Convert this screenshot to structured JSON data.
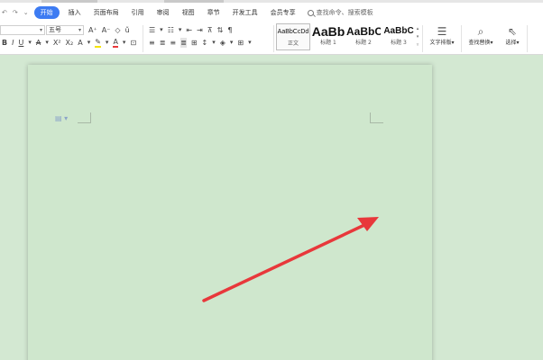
{
  "quick_access": {
    "undo_icon": "undo-icon",
    "redo_icon": "redo-icon",
    "dropdown_icon": "chevron-down-icon"
  },
  "menu": {
    "tabs": [
      {
        "label": "开始",
        "active": true
      },
      {
        "label": "插入"
      },
      {
        "label": "页面布局"
      },
      {
        "label": "引用"
      },
      {
        "label": "审阅"
      },
      {
        "label": "视图"
      },
      {
        "label": "章节"
      },
      {
        "label": "开发工具"
      },
      {
        "label": "会员专享"
      }
    ],
    "search_placeholder": "查找命令、搜索模板"
  },
  "ribbon": {
    "font_name": "",
    "font_size": "五号",
    "styles": [
      {
        "sample": "AaBbCcDd",
        "name": "正文"
      },
      {
        "sample": "AaBb",
        "name": "标题 1"
      },
      {
        "sample": "AaBbC",
        "name": "标题 2"
      },
      {
        "sample": "AaBbC",
        "name": "标题 3"
      }
    ],
    "text_layout_label": "文字排版",
    "find_replace_label": "查找替换",
    "select_label": "选择"
  },
  "colors": {
    "accent": "#3d7bf2",
    "page_bg": "#cfe7cd",
    "workspace_bg": "#d3e8d2",
    "arrow": "#e8383b",
    "highlight": "#f5e400",
    "font_color": "#e8383b"
  }
}
